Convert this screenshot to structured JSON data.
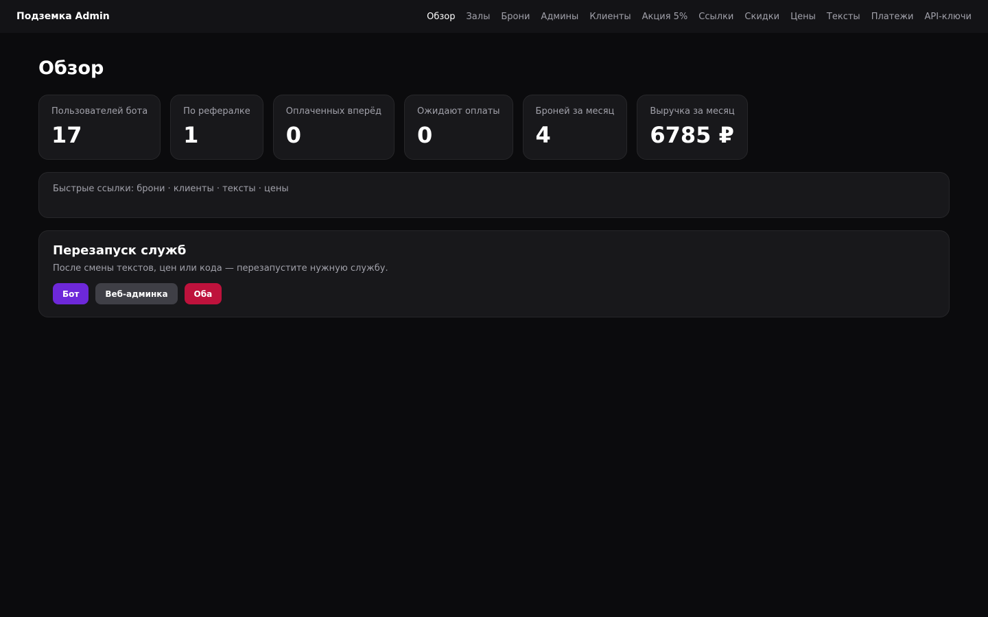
{
  "brand": "Подземка Admin",
  "nav": [
    {
      "label": "Обзор",
      "active": true
    },
    {
      "label": "Залы"
    },
    {
      "label": "Брони"
    },
    {
      "label": "Админы"
    },
    {
      "label": "Клиенты"
    },
    {
      "label": "Акция 5%"
    },
    {
      "label": "Ссылки"
    },
    {
      "label": "Скидки"
    },
    {
      "label": "Цены"
    },
    {
      "label": "Тексты"
    },
    {
      "label": "Платежи"
    },
    {
      "label": "API-ключи"
    }
  ],
  "page_title": "Обзор",
  "stats": [
    {
      "label": "Пользователей бота",
      "value": "17"
    },
    {
      "label": "По рефералке",
      "value": "1"
    },
    {
      "label": "Оплаченных вперёд",
      "value": "0"
    },
    {
      "label": "Ожидают оплаты",
      "value": "0"
    },
    {
      "label": "Броней за месяц",
      "value": "4"
    },
    {
      "label": "Выручка за месяц",
      "value": "6785 ₽"
    }
  ],
  "quick_links": {
    "prefix": "Быстрые ссылки: ",
    "separator": " · ",
    "items": [
      "брони",
      "клиенты",
      "тексты",
      "цены"
    ]
  },
  "restart": {
    "title": "Перезапуск служб",
    "description": "После смены текстов, цен или кода — перезапустите нужную службу.",
    "buttons": [
      {
        "label": "Бот",
        "color": "#6d28d9"
      },
      {
        "label": "Веб-админка",
        "color": "#3f3f46"
      },
      {
        "label": "Оба",
        "color": "#be123c"
      }
    ]
  }
}
